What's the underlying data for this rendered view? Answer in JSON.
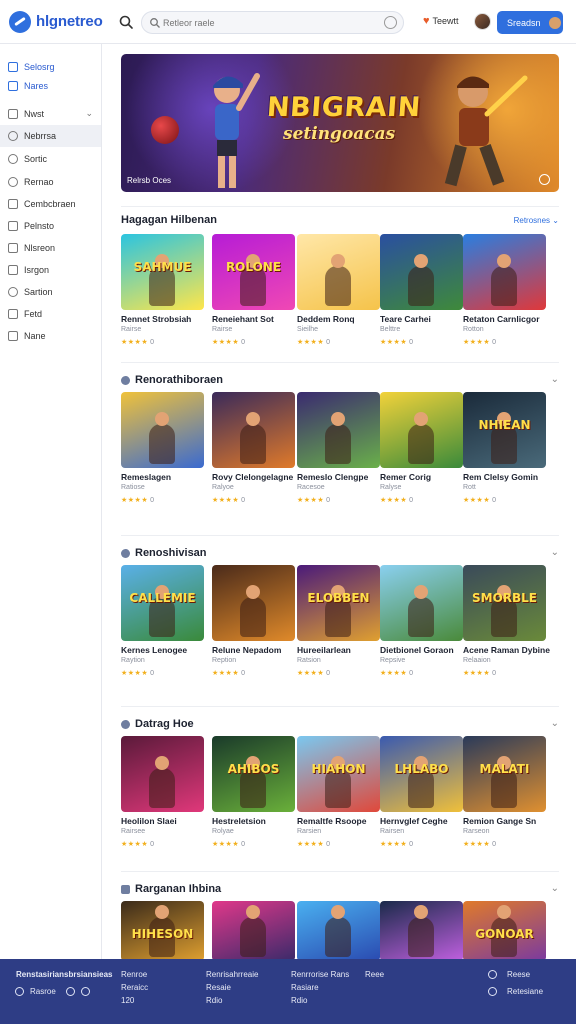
{
  "header": {
    "brand": "hlgnetreo",
    "search_placeholder": "Retleor raele",
    "link": "Teewtt",
    "cta": "Sreadsn"
  },
  "sidebar": {
    "items": [
      {
        "label": "Selosrg",
        "icon": "grid-icon"
      },
      {
        "label": "Nares",
        "icon": "star-icon"
      },
      {
        "label": "Nwst",
        "icon": "list-icon",
        "expandable": true
      },
      {
        "label": "Nebrrsa",
        "icon": "circle-icon",
        "active": true
      },
      {
        "label": "Sortic",
        "icon": "info-icon"
      },
      {
        "label": "Rernao",
        "icon": "search-icon"
      },
      {
        "label": "Cembcbraen",
        "icon": "calendar-icon"
      },
      {
        "label": "Pelnsto",
        "icon": "document-icon"
      },
      {
        "label": "Nlsreon",
        "icon": "box-icon"
      },
      {
        "label": "Isrgon",
        "icon": "bookmark-icon"
      },
      {
        "label": "Sartion",
        "icon": "search-icon"
      },
      {
        "label": "Fetd",
        "icon": "flag-icon"
      },
      {
        "label": "Nane",
        "icon": "tag-icon"
      }
    ]
  },
  "hero": {
    "title": "NBIGRAIN",
    "subtitle": "setingoacas",
    "caption": "Relrsb Oces"
  },
  "sections": [
    {
      "title": "Hagagan Hilbenan",
      "more": "Retrosnes",
      "cards": [
        {
          "title": "Rennet Strobsiah",
          "sub": "Rairse",
          "rating": "0",
          "stars": "★★★★",
          "thumb_text": "SAHMUE",
          "c1": "#2bc4e0",
          "c2": "#ffe64a"
        },
        {
          "title": "Reneiehant Sot",
          "sub": "Rairse",
          "rating": "0",
          "stars": "★★★★",
          "thumb_text": "ROLONE",
          "c1": "#b61cd6",
          "c2": "#f048b4"
        },
        {
          "title": "Deddem Ronq",
          "sub": "Sieilhe",
          "rating": "0",
          "stars": "★★★★",
          "thumb_text": "",
          "c1": "#ffe7a8",
          "c2": "#f5c34a"
        },
        {
          "title": "Teare Carhei",
          "sub": "Belttre",
          "rating": "0",
          "stars": "★★★★",
          "thumb_text": "",
          "c1": "#2a4fa0",
          "c2": "#3f8a3a"
        },
        {
          "title": "Retaton Carnlicgor",
          "sub": "Rotton",
          "rating": "0",
          "stars": "★★★★",
          "thumb_text": "",
          "c1": "#2a7ee0",
          "c2": "#e0383a"
        }
      ]
    },
    {
      "title": "Renorathiboraen",
      "cards": [
        {
          "title": "Remeslagen",
          "sub": "Ratiose",
          "rating": "0",
          "stars": "★★★★",
          "thumb_text": "",
          "c1": "#f0c23a",
          "c2": "#3a6ad0"
        },
        {
          "title": "Rovy Clelongelagne",
          "sub": "Ralyoe",
          "rating": "0",
          "stars": "★★★★",
          "thumb_text": "",
          "c1": "#3a2a5a",
          "c2": "#e07a2a"
        },
        {
          "title": "Remeslo Clengpe",
          "sub": "Racesoe",
          "rating": "0",
          "stars": "★★★★",
          "thumb_text": "",
          "c1": "#3a2a70",
          "c2": "#6ab04a"
        },
        {
          "title": "Remer Corig",
          "sub": "Ralyse",
          "rating": "0",
          "stars": "★★★★",
          "thumb_text": "",
          "c1": "#f2d23a",
          "c2": "#3a8a3a"
        },
        {
          "title": "Rem Clelsy Gomin",
          "sub": "Rott",
          "rating": "0",
          "stars": "★★★★",
          "thumb_text": "NHIEAN",
          "c1": "#1a2a3a",
          "c2": "#4a6a7a"
        }
      ]
    },
    {
      "title": "Renoshivisan",
      "cards": [
        {
          "title": "Kernes Lenogee",
          "sub": "Raytion",
          "rating": "0",
          "stars": "★★★★",
          "thumb_text": "CALLEMIE",
          "c1": "#5ab0e8",
          "c2": "#3a8a3a"
        },
        {
          "title": "Relune Nepadom",
          "sub": "Reption",
          "rating": "0",
          "stars": "★★★★",
          "thumb_text": "",
          "c1": "#4a2a1a",
          "c2": "#e08a2a"
        },
        {
          "title": "Hureeilarlean",
          "sub": "Ratsion",
          "rating": "0",
          "stars": "★★★★",
          "thumb_text": "ELOBBEN",
          "c1": "#4a1a7a",
          "c2": "#e0a030"
        },
        {
          "title": "Dietbionel Goraon",
          "sub": "Repsive",
          "rating": "0",
          "stars": "★★★★",
          "thumb_text": "",
          "c1": "#8ad0f0",
          "c2": "#4a8a3a"
        },
        {
          "title": "Acene Raman Dybine",
          "sub": "Relaaion",
          "rating": "0",
          "stars": "★★★★",
          "thumb_text": "SMORBLE",
          "c1": "#3a4a5a",
          "c2": "#6a8a3a"
        }
      ]
    },
    {
      "title": "Datrag Hoe",
      "cards": [
        {
          "title": "Heolilon Slaei",
          "sub": "Rairsee",
          "rating": "0",
          "stars": "★★★★",
          "thumb_text": "",
          "c1": "#5a1a3a",
          "c2": "#e0387a"
        },
        {
          "title": "Hestreletsion",
          "sub": "Rolyae",
          "rating": "0",
          "stars": "★★★★",
          "thumb_text": "AHIBOS",
          "c1": "#1a3a2a",
          "c2": "#6ab03a"
        },
        {
          "title": "Remaltfe Rsoope",
          "sub": "Rarsien",
          "rating": "0",
          "stars": "★★★★",
          "thumb_text": "HIAHON",
          "c1": "#7ac8f0",
          "c2": "#e0483a"
        },
        {
          "title": "Hernvglef Ceghe",
          "sub": "Rairsen",
          "rating": "0",
          "stars": "★★★★",
          "thumb_text": "LHLABO",
          "c1": "#3a5ab0",
          "c2": "#f0c03a"
        },
        {
          "title": "Remion Gange Sn",
          "sub": "Rarseon",
          "rating": "0",
          "stars": "★★★★",
          "thumb_text": "MALATI",
          "c1": "#2a3a5a",
          "c2": "#e09030"
        }
      ]
    },
    {
      "title": "Rarganan Ihbina",
      "cards": [
        {
          "title": "",
          "sub": "",
          "rating": "",
          "stars": "",
          "thumb_text": "HIHESON",
          "c1": "#3a2a1a",
          "c2": "#e0a030"
        },
        {
          "title": "",
          "sub": "",
          "rating": "",
          "stars": "",
          "thumb_text": "",
          "c1": "#e0388a",
          "c2": "#3a2a6a"
        },
        {
          "title": "",
          "sub": "",
          "rating": "",
          "stars": "",
          "thumb_text": "",
          "c1": "#4ab0f0",
          "c2": "#2a4ab0"
        },
        {
          "title": "",
          "sub": "",
          "rating": "",
          "stars": "",
          "thumb_text": "",
          "c1": "#1a2a4a",
          "c2": "#c060e0"
        },
        {
          "title": "",
          "sub": "",
          "rating": "",
          "stars": "",
          "thumb_text": "GONOAR",
          "c1": "#e07a2a",
          "c2": "#7a3aa0"
        }
      ]
    }
  ],
  "footer": {
    "col1": [
      "Renstasiriansbrsiansieas",
      "Rasroe"
    ],
    "col2": [
      "Renroe",
      "Reraicc",
      "120"
    ],
    "col3": [
      "Renrisahrreaie",
      "Resaie",
      "Rdio"
    ],
    "col4": [
      "Renrrorise Rans",
      "Rasiare",
      "Rdio"
    ],
    "col5": [
      "Reee"
    ],
    "col6": [
      "Reese",
      "Retesiane"
    ]
  }
}
